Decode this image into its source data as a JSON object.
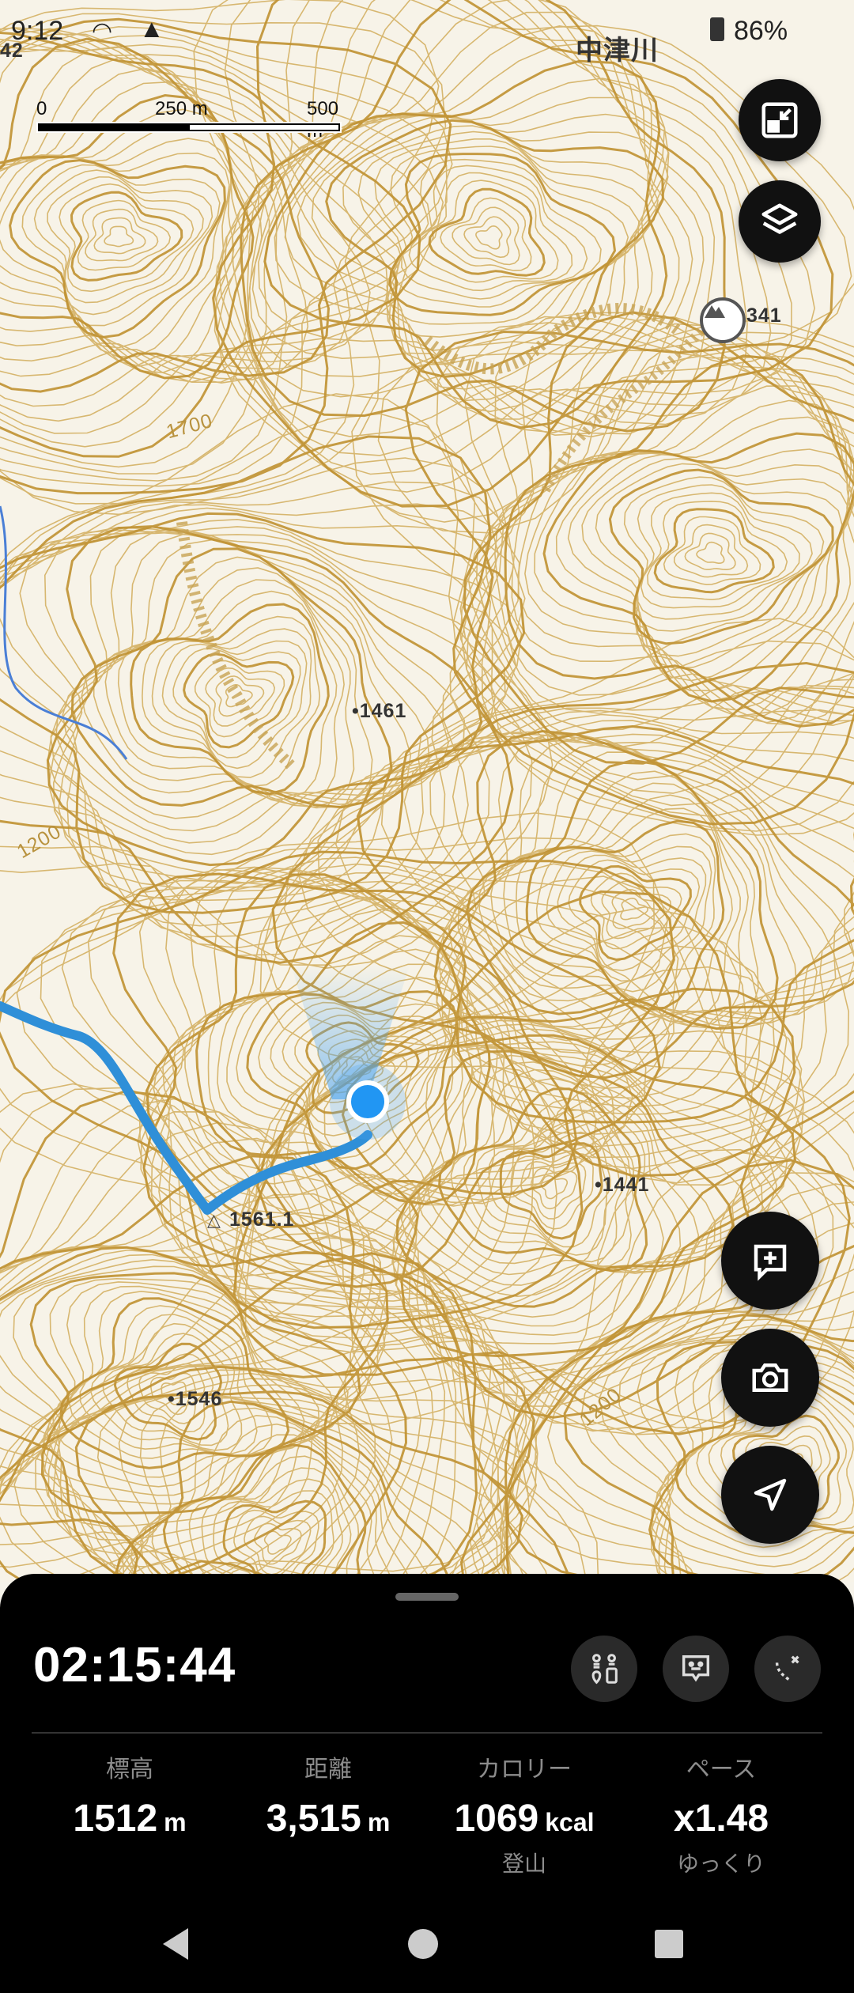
{
  "status_bar": {
    "time": "9:12",
    "battery": "86%"
  },
  "scale": {
    "start": "0",
    "mid": "250 m",
    "end": "500 m"
  },
  "map_labels": {
    "peak_341": "341",
    "elev_1461": "•1461",
    "elev_1441": "•1441",
    "elev_1561": "1561.1",
    "elev_1546": "•1546",
    "contour_1200a": "1200",
    "contour_1200b": "1200",
    "contour_1700": "1700",
    "place_top": "中津川",
    "edge_42": "42"
  },
  "buttons": {
    "fullscreen": "fullscreen-exit-icon",
    "layers": "layers-icon",
    "add_memo": "add-note-icon",
    "camera": "camera-icon",
    "locate": "navigation-arrow-icon"
  },
  "activity": {
    "elapsed": "02:15:44",
    "stats": [
      {
        "label": "標高",
        "value": "1512",
        "unit": "m",
        "sub": ""
      },
      {
        "label": "距離",
        "value": "3,515",
        "unit": "m",
        "sub": ""
      },
      {
        "label": "カロリー",
        "value": "1069",
        "unit": "kcal",
        "sub": "登山"
      },
      {
        "label": "ペース",
        "value": "x1.48",
        "unit": "",
        "sub": "ゆっくり"
      }
    ]
  },
  "colors": {
    "contour": "#c9a24a",
    "route": "#2f8fd8",
    "water": "#4a7fd6",
    "location": "#2196f3"
  }
}
